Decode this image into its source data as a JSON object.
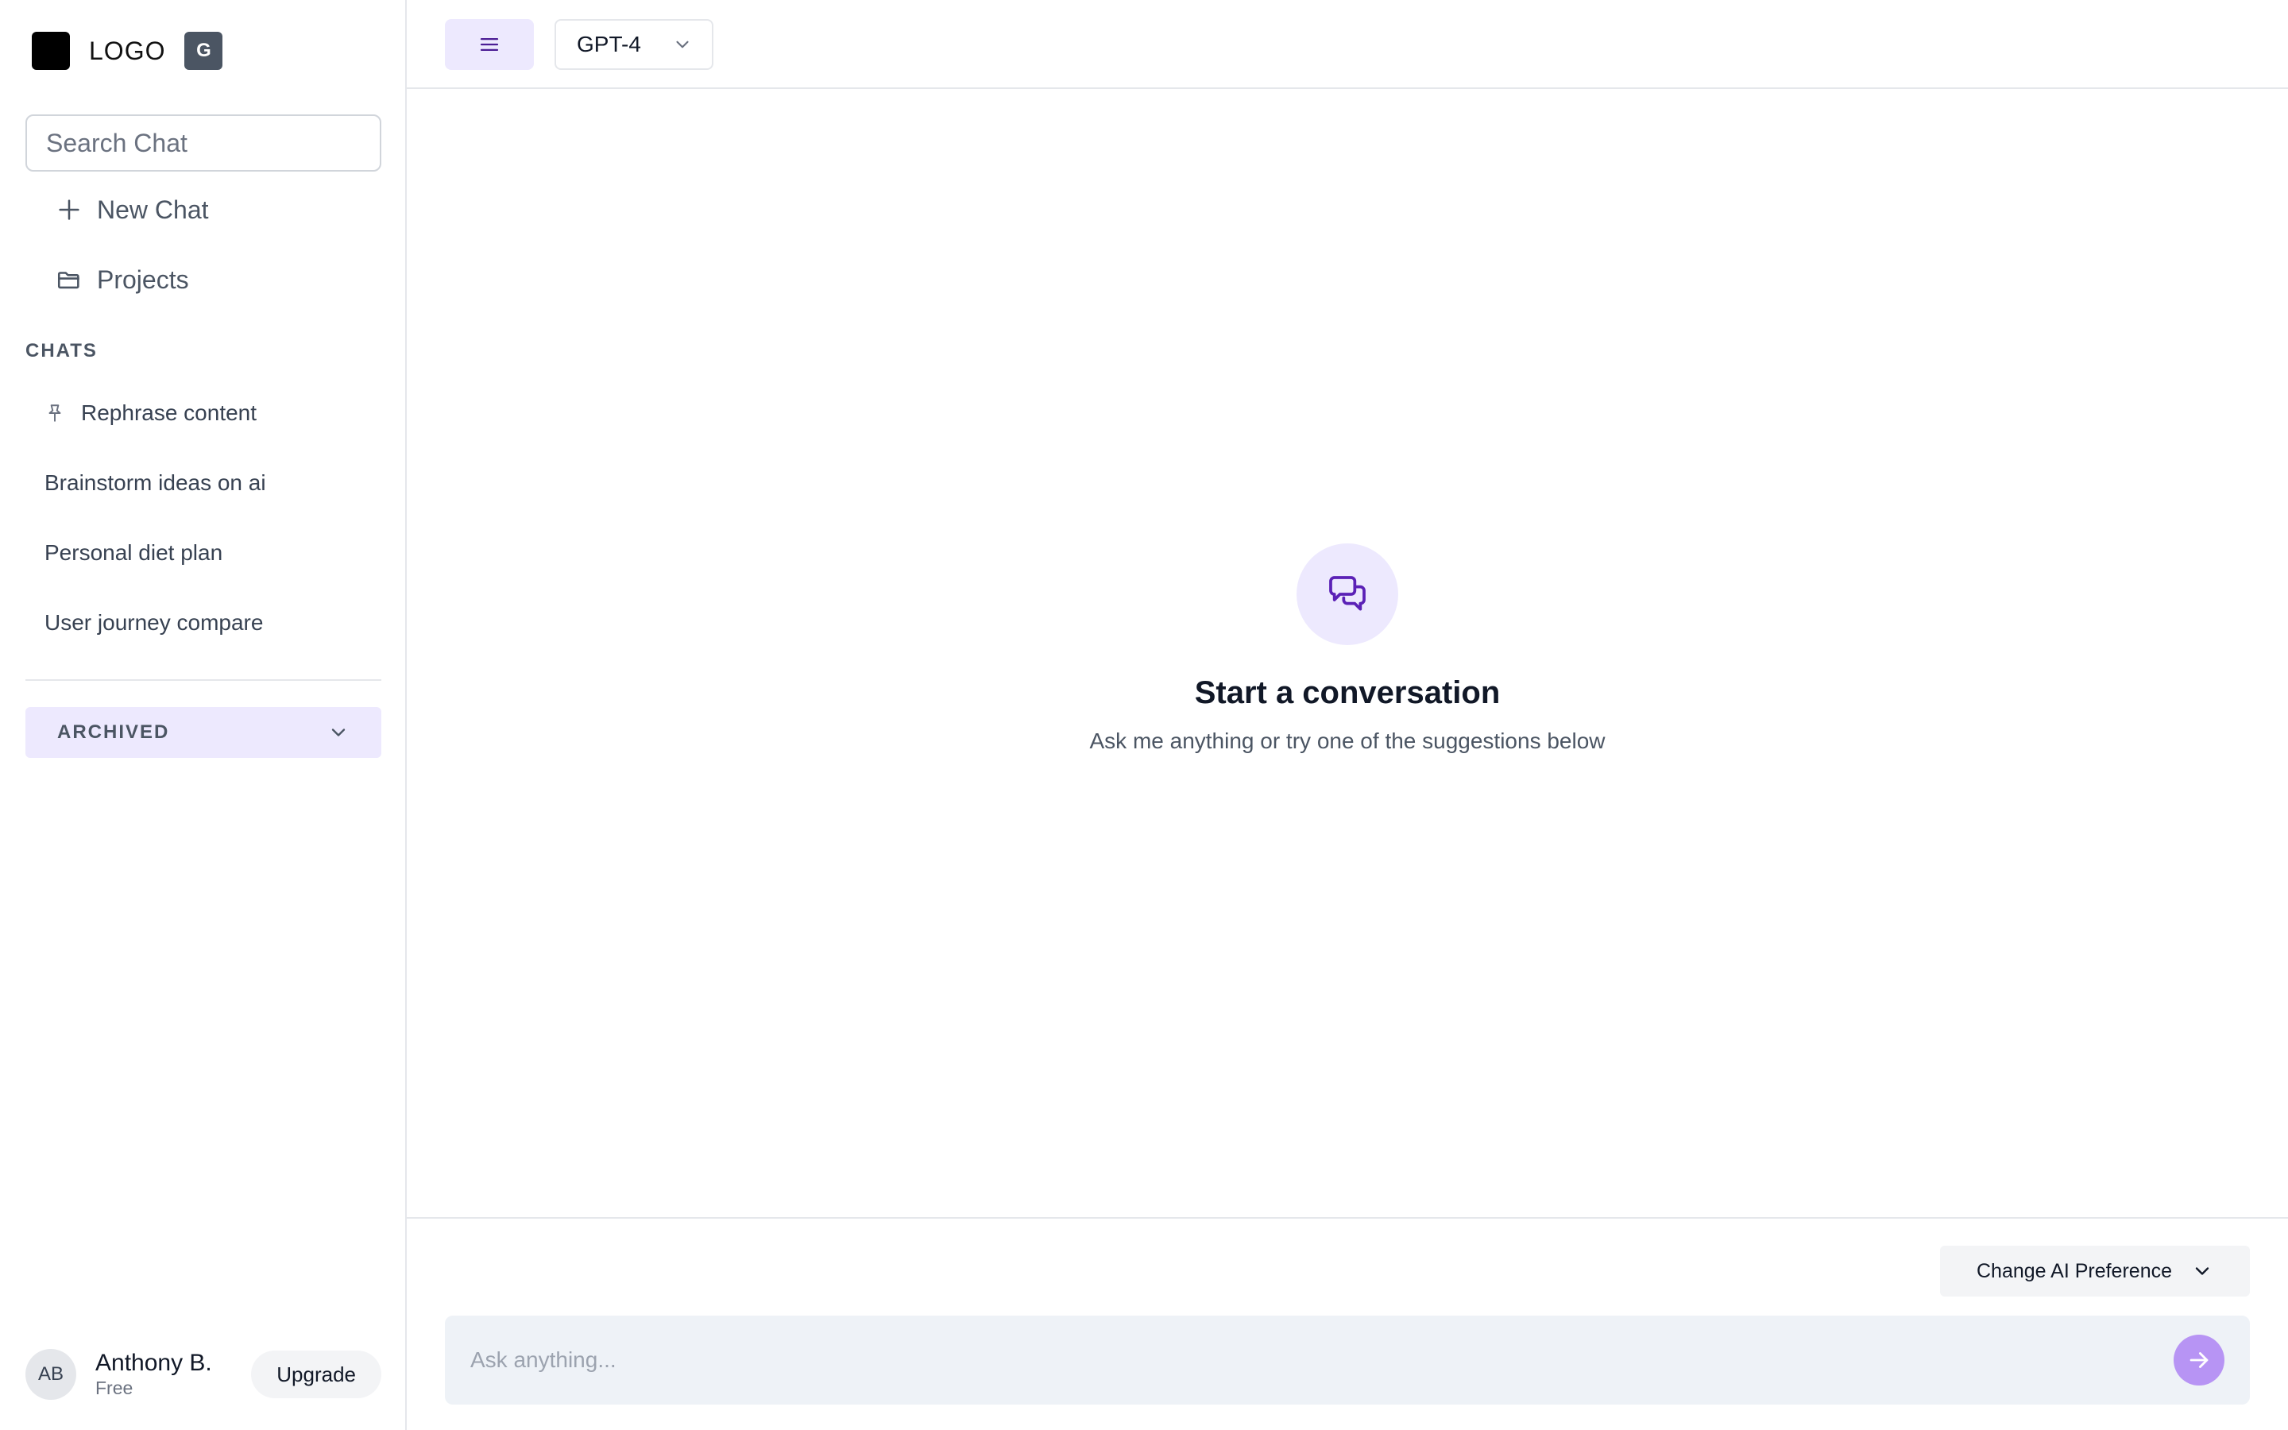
{
  "brand": {
    "logo_text": "LOGO",
    "badge": "G"
  },
  "search": {
    "placeholder": "Search Chat"
  },
  "nav": {
    "new_chat": "New Chat",
    "projects": "Projects"
  },
  "chats": {
    "section_label": "CHATS",
    "items": [
      {
        "label": "Rephrase content",
        "pinned": true
      },
      {
        "label": "Brainstorm ideas on ai",
        "pinned": false
      },
      {
        "label": "Personal diet plan",
        "pinned": false
      },
      {
        "label": "User journey compare",
        "pinned": false
      }
    ]
  },
  "archived": {
    "label": "ARCHIVED"
  },
  "user": {
    "initials": "AB",
    "name": "Anthony B.",
    "plan": "Free",
    "upgrade_label": "Upgrade"
  },
  "topbar": {
    "model": "GPT-4"
  },
  "empty_state": {
    "title": "Start a conversation",
    "subtitle": "Ask me anything or try one of the suggestions below"
  },
  "composer": {
    "placeholder": "Ask anything...",
    "preference_label": "Change AI Preference"
  },
  "colors": {
    "accent": "#6d28d9",
    "accent_soft": "#ede9fe",
    "send": "#b794f4"
  },
  "icons": {
    "search": "search-icon",
    "plus": "plus-icon",
    "folder": "folder-icon",
    "pin": "pin-icon",
    "chevron": "chevron-down-icon",
    "menu": "menu-icon",
    "chat": "chat-bubbles-icon",
    "send": "arrow-right-icon"
  }
}
